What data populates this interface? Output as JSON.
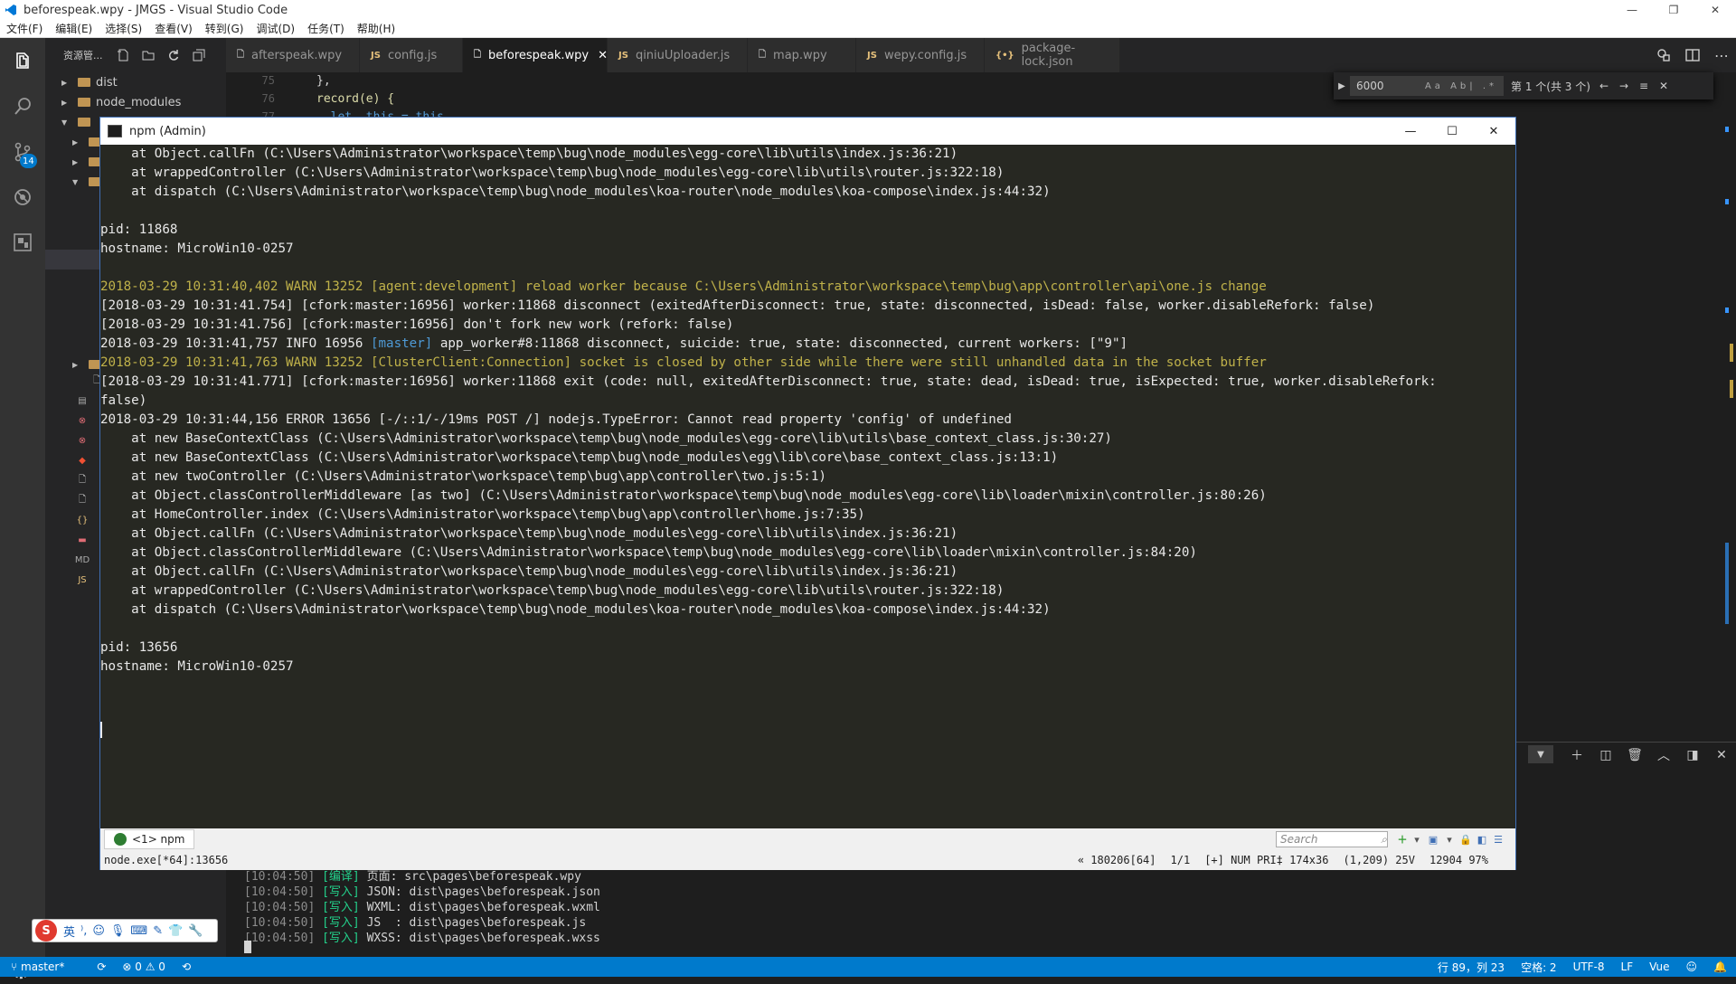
{
  "window": {
    "title": "beforespeak.wpy - JMGS - Visual Studio Code",
    "minimize": "—",
    "maximize": "❐",
    "close": "✕"
  },
  "menu": [
    "文件(F)",
    "编辑(E)",
    "选择(S)",
    "查看(V)",
    "转到(G)",
    "调试(D)",
    "任务(T)",
    "帮助(H)"
  ],
  "activity": {
    "scm_badge": "14",
    "icons": [
      "files-icon",
      "search-icon",
      "source-control-icon",
      "debug-icon",
      "extensions-icon",
      "gear-icon"
    ]
  },
  "explorer": {
    "title": "资源管...",
    "items": [
      {
        "label": "dist"
      },
      {
        "label": "node_modules"
      }
    ]
  },
  "tabs": [
    {
      "label": "afterspeak.wpy",
      "icon": "file-icon",
      "active": false
    },
    {
      "label": "config.js",
      "icon": "JS",
      "active": false
    },
    {
      "label": "beforespeak.wpy",
      "icon": "file-icon",
      "active": true
    },
    {
      "label": "qiniuUploader.js",
      "icon": "JS",
      "active": false
    },
    {
      "label": "map.wpy",
      "icon": "file-icon",
      "active": false
    },
    {
      "label": "wepy.config.js",
      "icon": "JS",
      "active": false
    },
    {
      "label": "package-lock.json",
      "icon": "{•}",
      "active": false
    }
  ],
  "editor": {
    "line_numbers": [
      "75",
      "76",
      "77"
    ],
    "code": [
      "},",
      "record(e) {",
      "  let _this = this"
    ]
  },
  "find": {
    "value": "6000",
    "options": "Aa  Ab|  .*",
    "count": "第 1 个(共 3 个)"
  },
  "conemu": {
    "title": "npm (Admin)",
    "lines": [
      {
        "text": "    at Object.callFn (C:\\Users\\Administrator\\workspace\\temp\\bug\\node_modules\\egg-core\\lib\\utils\\index.js:36:21)",
        "kind": "normal"
      },
      {
        "text": "    at wrappedController (C:\\Users\\Administrator\\workspace\\temp\\bug\\node_modules\\egg-core\\lib\\utils\\router.js:322:18)",
        "kind": "normal"
      },
      {
        "text": "    at dispatch (C:\\Users\\Administrator\\workspace\\temp\\bug\\node_modules\\koa-router\\node_modules\\koa-compose\\index.js:44:32)",
        "kind": "normal"
      },
      {
        "text": "",
        "kind": "normal"
      },
      {
        "text": "pid: 11868",
        "kind": "normal"
      },
      {
        "text": "hostname: MicroWin10-0257",
        "kind": "normal"
      },
      {
        "text": "",
        "kind": "normal"
      },
      {
        "text": "2018-03-29 10:31:40,402 WARN 13252 [agent:development] reload worker because C:\\Users\\Administrator\\workspace\\temp\\bug\\app\\controller\\api\\one.js change",
        "kind": "warn"
      },
      {
        "text": "[2018-03-29 10:31:41.754] [cfork:master:16956] worker:11868 disconnect (exitedAfterDisconnect: true, state: disconnected, isDead: false, worker.disableRefork: false)",
        "kind": "normal"
      },
      {
        "text": "[2018-03-29 10:31:41.756] [cfork:master:16956] don't fork new work (refork: false)",
        "kind": "normal"
      },
      {
        "text": "2018-03-29 10:31:41,757 INFO 16956 |[master]| app_worker#8:11868 disconnect, suicide: true, state: disconnected, current workers: [\"9\"]",
        "kind": "info"
      },
      {
        "text": "2018-03-29 10:31:41,763 WARN 13252 [ClusterClient:Connection] socket is closed by other side while there were still unhandled data in the socket buffer",
        "kind": "warn"
      },
      {
        "text": "[2018-03-29 10:31:41.771] [cfork:master:16956] worker:11868 exit (code: null, exitedAfterDisconnect: true, state: dead, isDead: true, isExpected: true, worker.disableRefork:",
        "kind": "normal"
      },
      {
        "text": "false)",
        "kind": "normal"
      },
      {
        "text": "2018-03-29 10:31:44,156 ERROR 13656 [-/::1/-/19ms POST /] nodejs.TypeError: Cannot read property 'config' of undefined",
        "kind": "normal"
      },
      {
        "text": "    at new BaseContextClass (C:\\Users\\Administrator\\workspace\\temp\\bug\\node_modules\\egg-core\\lib\\utils\\base_context_class.js:30:27)",
        "kind": "normal"
      },
      {
        "text": "    at new BaseContextClass (C:\\Users\\Administrator\\workspace\\temp\\bug\\node_modules\\egg\\lib\\core\\base_context_class.js:13:1)",
        "kind": "normal"
      },
      {
        "text": "    at new twoController (C:\\Users\\Administrator\\workspace\\temp\\bug\\app\\controller\\two.js:5:1)",
        "kind": "normal"
      },
      {
        "text": "    at Object.classControllerMiddleware [as two] (C:\\Users\\Administrator\\workspace\\temp\\bug\\node_modules\\egg-core\\lib\\loader\\mixin\\controller.js:80:26)",
        "kind": "normal"
      },
      {
        "text": "    at HomeController.index (C:\\Users\\Administrator\\workspace\\temp\\bug\\app\\controller\\home.js:7:35)",
        "kind": "normal"
      },
      {
        "text": "    at Object.callFn (C:\\Users\\Administrator\\workspace\\temp\\bug\\node_modules\\egg-core\\lib\\utils\\index.js:36:21)",
        "kind": "normal"
      },
      {
        "text": "    at Object.classControllerMiddleware (C:\\Users\\Administrator\\workspace\\temp\\bug\\node_modules\\egg-core\\lib\\loader\\mixin\\controller.js:84:20)",
        "kind": "normal"
      },
      {
        "text": "    at Object.callFn (C:\\Users\\Administrator\\workspace\\temp\\bug\\node_modules\\egg-core\\lib\\utils\\index.js:36:21)",
        "kind": "normal"
      },
      {
        "text": "    at wrappedController (C:\\Users\\Administrator\\workspace\\temp\\bug\\node_modules\\egg-core\\lib\\utils\\router.js:322:18)",
        "kind": "normal"
      },
      {
        "text": "    at dispatch (C:\\Users\\Administrator\\workspace\\temp\\bug\\node_modules\\koa-router\\node_modules\\koa-compose\\index.js:44:32)",
        "kind": "normal"
      },
      {
        "text": "",
        "kind": "normal"
      },
      {
        "text": "pid: 13656",
        "kind": "normal"
      },
      {
        "text": "hostname: MicroWin10-0257",
        "kind": "normal"
      }
    ],
    "tab_label": "<1> npm",
    "search_placeholder": "Search",
    "status_left": "node.exe[*64]:13656",
    "status_right": [
      "« 180206[64]",
      "1/1",
      "[+] NUM PRI‡ 174x36",
      "(1,209) 25V",
      "12904 97%"
    ]
  },
  "panel": {
    "lines": [
      {
        "ts": "[10:04:50]",
        "tag": "[编译]",
        "text": " 页面: src\\pages\\beforespeak.wpy"
      },
      {
        "ts": "[10:04:50]",
        "tag": "[写入]",
        "text": " JSON: dist\\pages\\beforespeak.json"
      },
      {
        "ts": "[10:04:50]",
        "tag": "[写入]",
        "text": " WXML: dist\\pages\\beforespeak.wxml"
      },
      {
        "ts": "[10:04:50]",
        "tag": "[写入]",
        "text": " JS  : dist\\pages\\beforespeak.js"
      },
      {
        "ts": "[10:04:50]",
        "tag": "[写入]",
        "text": " WXSS: dist\\pages\\beforespeak.wxss"
      }
    ]
  },
  "ime": {
    "lang": "英",
    "items": [
      "⁾,",
      "☺",
      "🎙",
      "⌨",
      "✎",
      "👕",
      "🔧"
    ]
  },
  "statusbar": {
    "branch": "master*",
    "sync": "⟳",
    "problems": "⊗ 0 ⚠ 0",
    "position": "行 89，列 23",
    "spaces": "空格: 2",
    "encoding": "UTF-8",
    "eol": "LF",
    "language": "Vue"
  },
  "colors": {
    "accent": "#007acc",
    "terminal_bg": "#272822",
    "warn": "#c0b24a",
    "info_tag": "#4e9ad6"
  }
}
